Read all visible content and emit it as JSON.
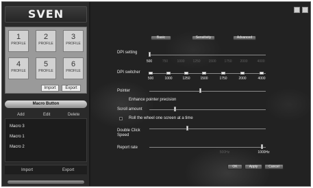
{
  "brand": "SVEN",
  "profiles": [
    {
      "number": "1",
      "label": "PROFILE"
    },
    {
      "number": "2",
      "label": "PROFILE"
    },
    {
      "number": "3",
      "label": "PROFILE"
    },
    {
      "number": "4",
      "label": "PROFILE"
    },
    {
      "number": "5",
      "label": "PROFILE"
    },
    {
      "number": "6",
      "label": "PROFILE"
    }
  ],
  "profile_actions": {
    "import": "Import",
    "export": "Export"
  },
  "macro": {
    "header": "Macro Button",
    "tools": {
      "add": "Add",
      "edit": "Edit",
      "delete": "Delete"
    },
    "items": [
      "Macro 3",
      "Macro 1",
      "Macro 2"
    ],
    "import": "Import",
    "export": "Export"
  },
  "window_icons": [
    "minimize-icon",
    "close-icon"
  ],
  "tabs": [
    "Basic",
    "Sensitivity",
    "Advanced"
  ],
  "dpi_setting": {
    "label": "DPI setting",
    "ticks": [
      "500",
      "750",
      "1000",
      "1250",
      "1500",
      "1750",
      "2000",
      "4000"
    ],
    "selected": "500"
  },
  "dpi_switcher": {
    "label": "DPI switcher",
    "values": [
      "500",
      "1000",
      "1250",
      "1500",
      "1750",
      "2000",
      "4000"
    ]
  },
  "pointer": {
    "label": "Pointer",
    "sublabel": "Enhance pointer precision",
    "level": 0.5
  },
  "scroll": {
    "label": "Scroll amount",
    "checkbox_label": "Roll the wheel one screen at a time",
    "level": 0.25,
    "checked": false
  },
  "double_click": {
    "label_line1": "Double Click",
    "label_line2": "Speed",
    "level": 0.37
  },
  "report_rate": {
    "label": "Report rate",
    "ticks": [
      "500Hz",
      "1000Hz"
    ],
    "selected": "1000Hz"
  },
  "buttons": {
    "ok": "OK",
    "apply": "Apply",
    "cancel": "Cancel"
  },
  "colors": {
    "background": "#222222",
    "panel": "#2a2a2a",
    "profile_card": "#d2d2d2",
    "text": "#ececec"
  }
}
